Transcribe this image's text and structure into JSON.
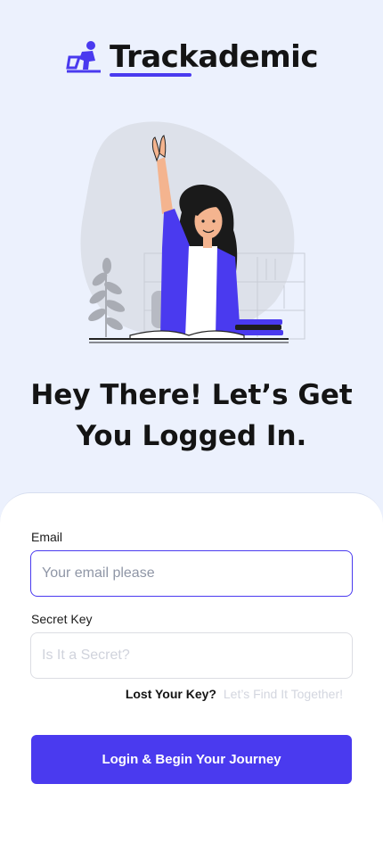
{
  "brand": {
    "name": "Trackademic",
    "logo_icon": "running-student-icon"
  },
  "hero": {
    "illustration": "student-raising-hand-illustration"
  },
  "headline": {
    "line1": "Hey There! Let’s Get",
    "line2": "You Logged In."
  },
  "form": {
    "email": {
      "label": "Email",
      "placeholder": "Your email please",
      "value": ""
    },
    "password": {
      "label": "Secret Key",
      "placeholder": "Is It a Secret?",
      "value": ""
    },
    "forgot": {
      "question": "Lost Your Key?",
      "link": "Let’s Find It Together!"
    },
    "submit_label": "Login & Begin Your Journey"
  },
  "colors": {
    "accent": "#4a3aef",
    "background": "#ecf1fd",
    "text": "#141414"
  }
}
